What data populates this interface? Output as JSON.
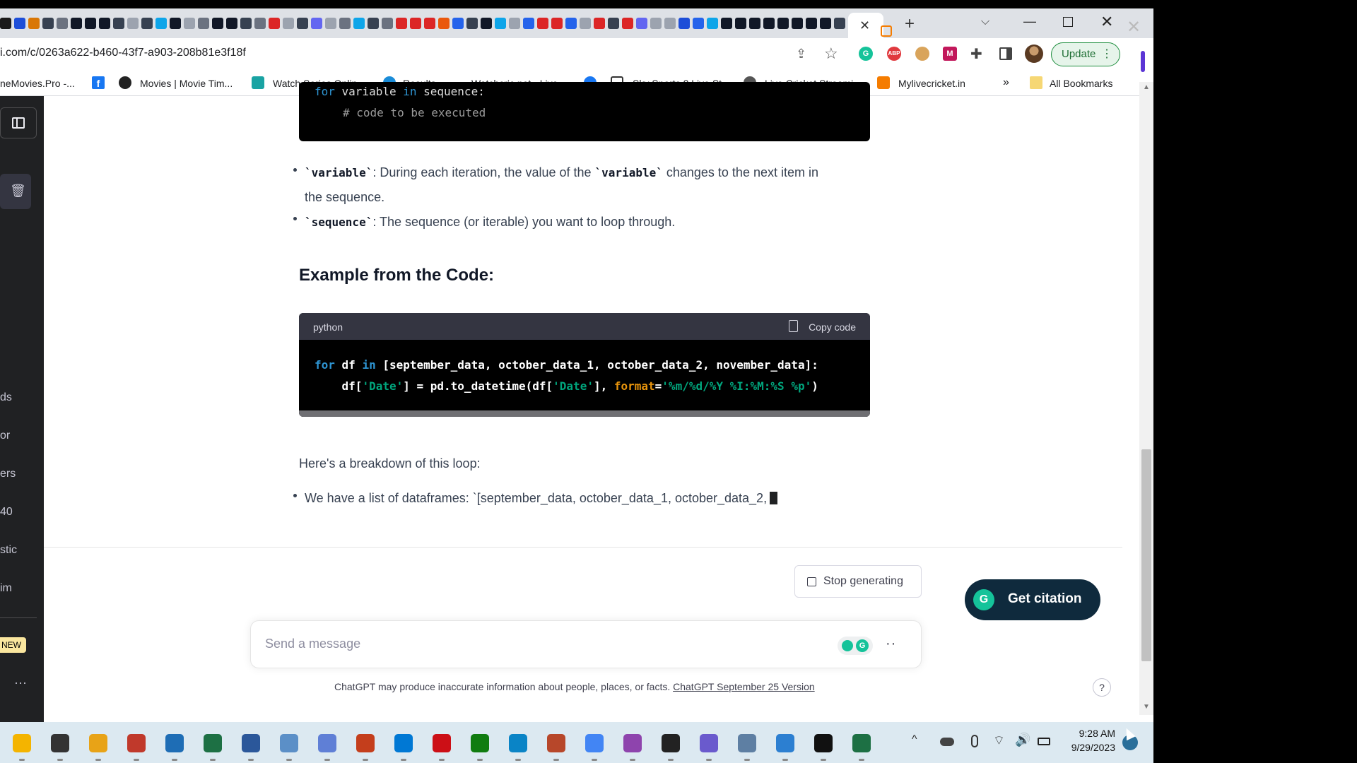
{
  "browser": {
    "url": "i.com/c/0263a622-b460-43f7-a903-208b81e3f18f",
    "tab_favicon_colors": [
      "#1a1a1a",
      "#1d4ed8",
      "#d97706",
      "#374151",
      "#6b7280",
      "#111827",
      "#111827",
      "#111827",
      "#374151",
      "#9ca3af",
      "#374151",
      "#0ea5e9",
      "#111827",
      "#9ca3af",
      "#6b7280",
      "#111827",
      "#111827",
      "#374151",
      "#6b7280",
      "#dc2626",
      "#9ca3af",
      "#374151",
      "#6366f1",
      "#9ca3af",
      "#6b7280",
      "#0ea5e9",
      "#374151",
      "#6b7280",
      "#dc2626",
      "#dc2626",
      "#dc2626",
      "#ea580c",
      "#2563eb",
      "#374151",
      "#111827",
      "#0ea5e9",
      "#9ca3af",
      "#2563eb",
      "#dc2626",
      "#dc2626",
      "#2563eb",
      "#9ca3af",
      "#dc2626",
      "#374151",
      "#dc2626",
      "#6366f1",
      "#9ca3af",
      "#9ca3af",
      "#1d4ed8",
      "#2563eb",
      "#0ea5e9",
      "#111827",
      "#111827",
      "#111827",
      "#111827",
      "#111827",
      "#111827",
      "#111827",
      "#111827",
      "#374151",
      "#111827"
    ],
    "active_tab_close": "✕",
    "new_tab": "+",
    "tab_search": "⌵",
    "minimize": "—",
    "close": "✕",
    "share_icon": "⇪",
    "star_icon": "☆",
    "ext_grammarly": "G",
    "ext_abp": "ABP",
    "ext_m": "M",
    "ext_puzzle": "✚",
    "update_label": "Update",
    "update_menu": "⋮",
    "bookmarks": [
      {
        "label": "neMovies.Pro -..."
      },
      {
        "label": "f"
      },
      {
        "label": "Movies | Movie Tim..."
      },
      {
        "label": "Watch Series Onlin..."
      },
      {
        "label": "Results"
      },
      {
        "label": "Watchcric.net - Live..."
      },
      {
        "label": "Sky Sports 2 Live St..."
      },
      {
        "label": "Live Cricket Streami..."
      },
      {
        "label": "Mylivecricket.in"
      },
      {
        "label": "All Bookmarks"
      }
    ],
    "bookmark_overflow": "»"
  },
  "sidebar": {
    "fragments": [
      "ds",
      "or",
      "ers",
      "40",
      "stic",
      "im"
    ],
    "new_badge": "NEW",
    "more": "···"
  },
  "content": {
    "code_top": {
      "line1_kw": "for",
      "line1_rest": " variable ",
      "line1_in": "in",
      "line1_end": " sequence:",
      "comment": "# code to be executed"
    },
    "bullet1_code": "`variable`",
    "bullet1_text_a": ": During each iteration, the value of the ",
    "bullet1_code2": "`variable`",
    "bullet1_text_b": " changes to the next item in",
    "bullet1_text_c": "the sequence.",
    "bullet2_code": "`sequence`",
    "bullet2_text": ": The sequence (or iterable) you want to loop through.",
    "example_heading": "Example from the Code:",
    "code_main": {
      "lang": "python",
      "copy_label": "Copy code",
      "l1_for": "for",
      "l1_a": " df ",
      "l1_in": "in",
      "l1_b": " [september_data, october_data_1, october_data_2, november_data]:",
      "l2_a": "    df[",
      "l2_date1": "'Date'",
      "l2_b": "] = pd.to_datetime(df[",
      "l2_date2": "'Date'",
      "l2_c": "], ",
      "l2_format": "format",
      "l2_eq": "=",
      "l2_fmtstr": "'%m/%d/%Y %I:%M:%S %p'",
      "l2_d": ")"
    },
    "breakdown": "Here's a breakdown of this loop:",
    "bullet3_text": "We have a list of dataframes:  `[september_data, october_data_1, october_data_2,"
  },
  "composer": {
    "stop_label": "Stop generating",
    "citation_label": "Get citation",
    "citation_icon": "G",
    "placeholder": "Send a message",
    "ext_g": "G",
    "send_dots": "··",
    "footer_text": "ChatGPT may produce inaccurate information about people, places, or facts. ",
    "footer_link": "ChatGPT September 25 Version",
    "help": "?"
  },
  "taskbar": {
    "app_colors": [
      "#f4b400",
      "#333333",
      "#e8a317",
      "#c0392b",
      "#1e6db5",
      "#1d7044",
      "#2b579a",
      "#5b8fc7",
      "#5f7fd6",
      "#c43e1c",
      "#0078d4",
      "#cc0f16",
      "#107c10",
      "#0a84c6",
      "#b7472a",
      "#4285f4",
      "#8e44ad",
      "#222222",
      "#6a5acd",
      "#5e7fa3",
      "#2c7fd1",
      "#111111",
      "#1d7044"
    ],
    "tray_up": "^",
    "tray_wifi": "⌔",
    "tray_volume": "🔊",
    "time": "9:28 AM",
    "date": "9/29/2023"
  },
  "background": {
    "close": "✕"
  }
}
